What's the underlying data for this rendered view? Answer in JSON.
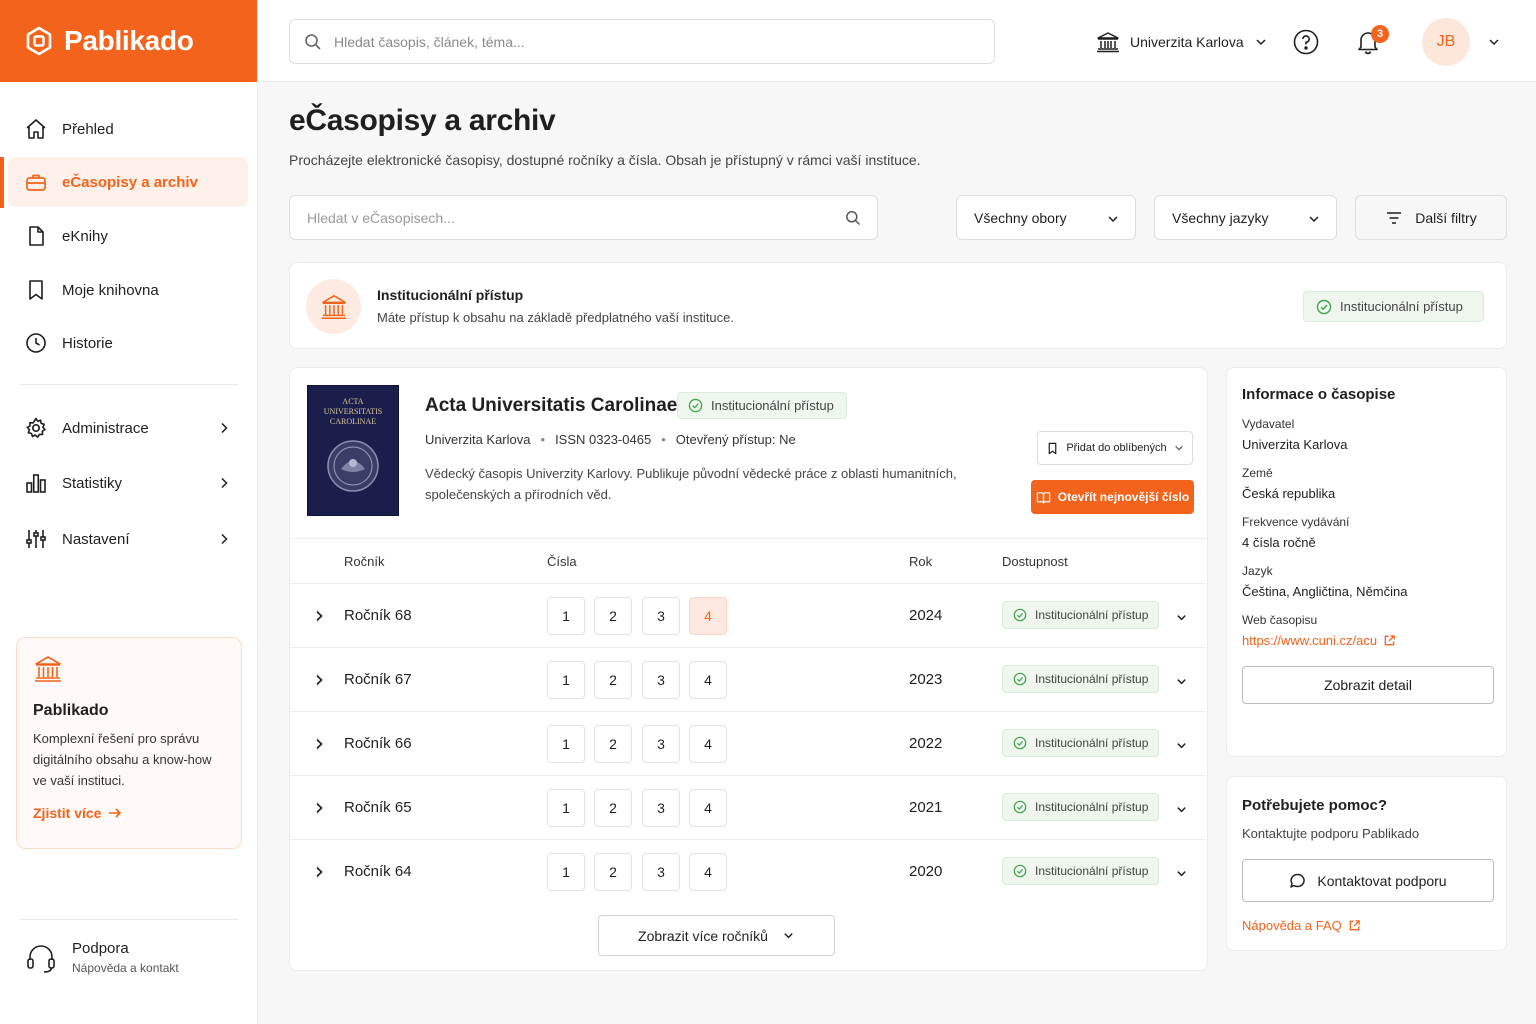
{
  "brand": {
    "name": "Pablikado",
    "accent": "#f4631b"
  },
  "sidebar": {
    "items": [
      {
        "label": "Přehled",
        "icon": "home-icon"
      },
      {
        "label": "eČasopisy a archiv",
        "icon": "briefcase-icon",
        "active": true
      },
      {
        "label": "eKnihy",
        "icon": "file-icon"
      },
      {
        "label": "Moje knihovna",
        "icon": "bookmark-icon"
      },
      {
        "label": "Historie",
        "icon": "clock-icon"
      }
    ],
    "admin_items": [
      {
        "label": "Administrace",
        "icon": "gear-icon"
      },
      {
        "label": "Statistiky",
        "icon": "bar-chart-icon"
      },
      {
        "label": "Nastavení",
        "icon": "sliders-icon"
      }
    ],
    "promo": {
      "title": "Pablikado",
      "text": "Komplexní řešení pro správu digitálního obsahu a know-how ve vaší instituci.",
      "link": "Zjistit více"
    },
    "support": {
      "title": "Podpora",
      "subtitle": "Nápověda a kontakt"
    }
  },
  "topbar": {
    "search_placeholder": "Hledat časopis, článek, téma...",
    "institution": "Univerzita Karlova",
    "notifications_count": "3",
    "avatar_initials": "JB"
  },
  "main": {
    "title": "eČasopisy a archiv",
    "subtitle": "Procházejte elektronické časopisy, dostupné ročníky a čísla. Obsah je přístupný v rámci vaší instituce.",
    "filter_placeholder": "Hledat v eČasopisech...",
    "filter_fields": "Všechny obory",
    "filter_languages": "Všechny jazyky",
    "more_filters": "Další filtry",
    "access_banner": {
      "title": "Institucionální přístup",
      "text": "Máte přístup k obsahu na základě předplatného vaší instituce.",
      "badge": "Institucionální přístup"
    }
  },
  "journal": {
    "cover_lines": [
      "ACTA",
      "UNIVERSITATIS",
      "CAROLINAE"
    ],
    "title": "Acta Universitatis Carolinae",
    "badge": "Institucionální přístup",
    "publisher": "Univerzita Karlova",
    "issn": "ISSN 0323-0465",
    "open_access": "Otevřený přístup: Ne",
    "description": "Vědecký časopis Univerzity Karlovy. Publikuje původní vědecké práce z oblasti humanitních, společenských a přírodních věd.",
    "favorite_button": "Přidat do oblíbených",
    "open_button": "Otevřít nejnovější číslo"
  },
  "volumes_table": {
    "headers": [
      "Ročník",
      "Čísla",
      "Rok",
      "Dostupnost"
    ],
    "rows": [
      {
        "label": "Ročník 68",
        "issues": [
          "1",
          "2",
          "3",
          "4"
        ],
        "highlight": 3,
        "year": "2024",
        "access": "Institucionální přístup"
      },
      {
        "label": "Ročník 67",
        "issues": [
          "1",
          "2",
          "3",
          "4"
        ],
        "highlight": -1,
        "year": "2023",
        "access": "Institucionální přístup"
      },
      {
        "label": "Ročník 66",
        "issues": [
          "1",
          "2",
          "3",
          "4"
        ],
        "highlight": -1,
        "year": "2022",
        "access": "Institucionální přístup"
      },
      {
        "label": "Ročník 65",
        "issues": [
          "1",
          "2",
          "3",
          "4"
        ],
        "highlight": -1,
        "year": "2021",
        "access": "Institucionální přístup"
      },
      {
        "label": "Ročník 64",
        "issues": [
          "1",
          "2",
          "3",
          "4"
        ],
        "highlight": -1,
        "year": "2020",
        "access": "Institucionální přístup"
      }
    ],
    "more_button": "Zobrazit více ročníků"
  },
  "info_panel": {
    "title": "Informace o časopise",
    "fields": [
      {
        "label": "Vydavatel",
        "value": "Univerzita Karlova"
      },
      {
        "label": "Země",
        "value": "Česká republika"
      },
      {
        "label": "Frekvence vydávání",
        "value": "4 čísla ročně"
      },
      {
        "label": "Jazyk",
        "value": "Čeština, Angličtina, Němčina"
      }
    ],
    "web_label": "Web časopisu",
    "web_url": "https://www.cuni.cz/acu",
    "detail_button": "Zobrazit detail"
  },
  "help_panel": {
    "title": "Potřebujete pomoc?",
    "text": "Kontaktujte podporu Pablikado",
    "contact_button": "Kontaktovat podporu",
    "faq_link": "Nápověda a FAQ"
  }
}
